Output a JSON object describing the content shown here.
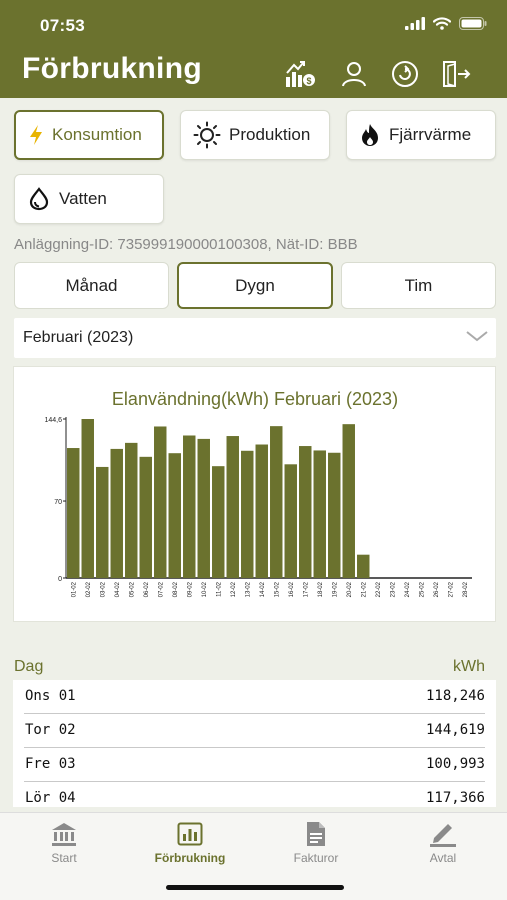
{
  "status_bar": {
    "time": "07:53"
  },
  "header": {
    "title": "Förbrukning",
    "icons": [
      "price-chart-icon",
      "user-icon",
      "refresh-icon",
      "logout-icon"
    ]
  },
  "energy_types": [
    {
      "label": "Konsumtion",
      "icon": "lightning-icon",
      "active": true
    },
    {
      "label": "Produktion",
      "icon": "sun-icon",
      "active": false
    },
    {
      "label": "Fjärrvärme",
      "icon": "flame-icon",
      "active": false
    },
    {
      "label": "Vatten",
      "icon": "water-drop-icon",
      "active": false
    }
  ],
  "ids_line": "Anläggning-ID: 735999190000100308, Nät-ID: BBB",
  "periods": [
    {
      "label": "Månad",
      "active": false
    },
    {
      "label": "Dygn",
      "active": true
    },
    {
      "label": "Tim",
      "active": false
    }
  ],
  "month_select": {
    "value": "Februari (2023)"
  },
  "colors": {
    "accent": "#6b722e",
    "bar": "#6b722e",
    "background": "#eef0e8"
  },
  "chart_data": {
    "type": "bar",
    "title": "Elanvändning(kWh) Februari (2023)",
    "xlabel": "",
    "ylabel": "",
    "ylim": [
      0,
      144.6
    ],
    "ytick_labels": [
      "0",
      "70",
      "144,6"
    ],
    "yticks": [
      0,
      70,
      144.6
    ],
    "categories": [
      "01-02",
      "02-02",
      "03-02",
      "04-02",
      "05-02",
      "06-02",
      "07-02",
      "08-02",
      "09-02",
      "10-02",
      "11-02",
      "12-02",
      "13-02",
      "14-02",
      "15-02",
      "16-02",
      "17-02",
      "18-02",
      "19-02",
      "20-02",
      "21-02",
      "22-02",
      "23-02",
      "24-02",
      "25-02",
      "26-02",
      "27-02",
      "28-02"
    ],
    "values": [
      118.2,
      144.6,
      101.0,
      117.4,
      122.9,
      110.2,
      137.8,
      113.5,
      129.6,
      126.5,
      101.7,
      129.1,
      115.7,
      121.4,
      138.1,
      103.4,
      120.0,
      116.0,
      113.9,
      139.9,
      21.2,
      0,
      0,
      0,
      0,
      0,
      0,
      0
    ],
    "grid": false,
    "legend": "none"
  },
  "table": {
    "head_left": "Dag",
    "head_right": "kWh",
    "rows": [
      {
        "day": "Ons 01",
        "value": "118,246"
      },
      {
        "day": "Tor 02",
        "value": "144,619"
      },
      {
        "day": "Fre 03",
        "value": "100,993"
      },
      {
        "day": "Lör 04",
        "value": "117,366"
      }
    ]
  },
  "tabbar": {
    "items": [
      {
        "label": "Start",
        "icon": "bank-icon",
        "active": false
      },
      {
        "label": "Förbrukning",
        "icon": "bar-chart-icon",
        "active": true
      },
      {
        "label": "Fakturor",
        "icon": "document-icon",
        "active": false
      },
      {
        "label": "Avtal",
        "icon": "pen-icon",
        "active": false
      }
    ]
  }
}
